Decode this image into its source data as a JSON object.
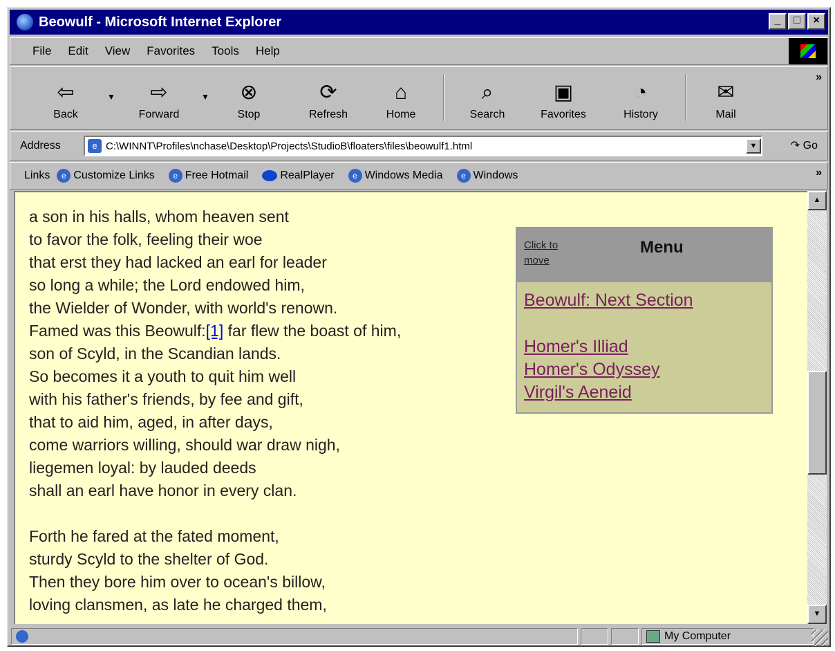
{
  "window": {
    "title": "Beowulf - Microsoft Internet Explorer"
  },
  "menu": [
    "File",
    "Edit",
    "View",
    "Favorites",
    "Tools",
    "Help"
  ],
  "toolbar": {
    "back": "Back",
    "forward": "Forward",
    "stop": "Stop",
    "refresh": "Refresh",
    "home": "Home",
    "search": "Search",
    "favorites": "Favorites",
    "history": "History",
    "mail": "Mail"
  },
  "address": {
    "label": "Address",
    "url": "C:\\WINNT\\Profiles\\nchase\\Desktop\\Projects\\StudioB\\floaters\\files\\beowulf1.html",
    "go": "Go"
  },
  "links": {
    "label": "Links",
    "items": [
      "Customize Links",
      "Free Hotmail",
      "RealPlayer",
      "Windows Media",
      "Windows"
    ]
  },
  "poem": {
    "lines1": [
      "a son in his halls, whom heaven sent",
      "to favor the folk, feeling their woe",
      "that erst they had lacked an earl for leader",
      "so long a while; the Lord endowed him,",
      "the Wielder of Wonder, with world's renown."
    ],
    "famed_pre": "Famed was this Beowulf:",
    "footnote": "[1]",
    "famed_post": " far flew the boast of him,",
    "lines2": [
      "son of Scyld, in the Scandian lands.",
      "So becomes it a youth to quit him well",
      "with his father's friends, by fee and gift,",
      "that to aid him, aged, in after days,",
      "come warriors willing, should war draw nigh,",
      "liegemen loyal: by lauded deeds",
      "shall an earl have honor in every clan."
    ],
    "lines3": [
      "Forth he fared at the fated moment,",
      "sturdy Scyld to the shelter of God.",
      "Then they bore him over to ocean's billow,",
      "loving clansmen, as late he charged them,"
    ]
  },
  "floater": {
    "click_to_move": "Click to move",
    "title": "Menu",
    "next": "Beowulf: Next Section",
    "links": [
      "Homer's Illiad",
      "Homer's Odyssey",
      "Virgil's Aeneid"
    ]
  },
  "status": {
    "zone": "My Computer"
  }
}
